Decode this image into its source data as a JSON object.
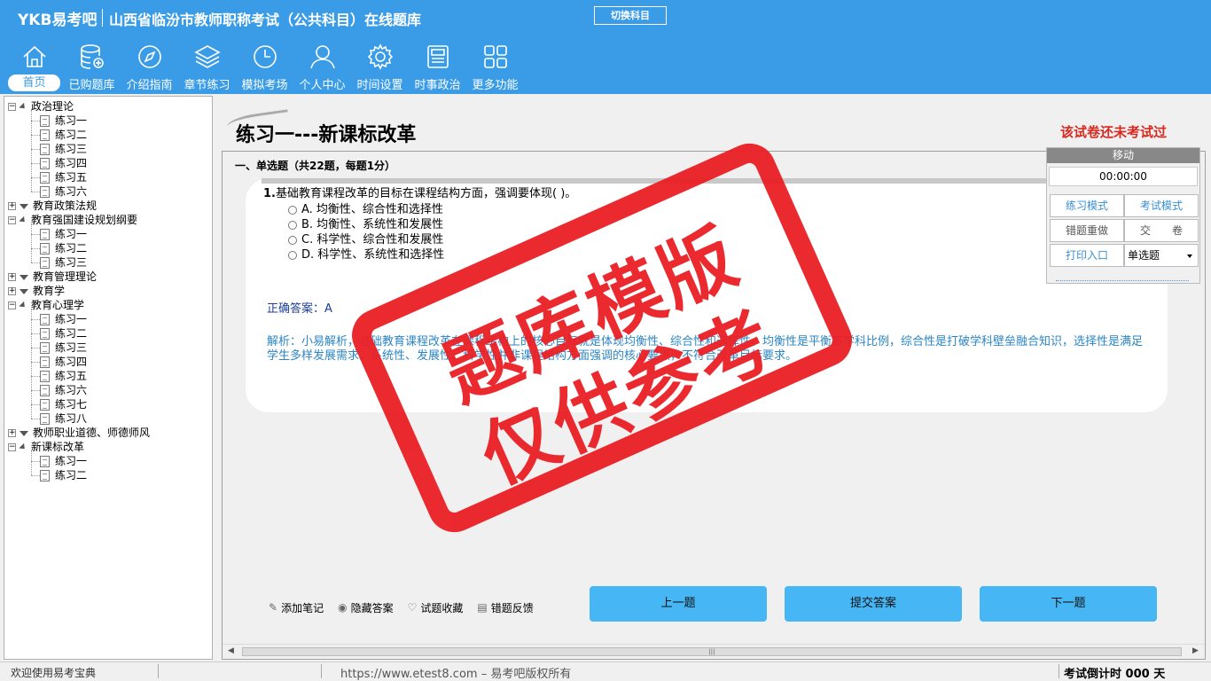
{
  "header": {
    "brand": "YKB易考吧",
    "title": "山西省临汾市教师职称考试（公共科目）在线题库",
    "switch_button": "切换科目"
  },
  "nav": [
    {
      "label": "首页",
      "icon": "home-icon"
    },
    {
      "label": "已购题库",
      "icon": "database-icon"
    },
    {
      "label": "介绍指南",
      "icon": "compass-icon"
    },
    {
      "label": "章节练习",
      "icon": "layers-icon"
    },
    {
      "label": "模拟考场",
      "icon": "clock-icon"
    },
    {
      "label": "个人中心",
      "icon": "user-icon"
    },
    {
      "label": "时间设置",
      "icon": "gear-icon"
    },
    {
      "label": "时事政治",
      "icon": "news-icon"
    },
    {
      "label": "更多功能",
      "icon": "grid-icon"
    }
  ],
  "tree": {
    "sections": [
      {
        "label": "政治理论",
        "expanded": true,
        "items": [
          "练习一",
          "练习二",
          "练习三",
          "练习四",
          "练习五",
          "练习六"
        ]
      },
      {
        "label": "教育政策法规",
        "expanded": false,
        "items": []
      },
      {
        "label": "教育强国建设规划纲要",
        "expanded": true,
        "items": [
          "练习一",
          "练习二",
          "练习三"
        ]
      },
      {
        "label": "教育管理理论",
        "expanded": false,
        "items": []
      },
      {
        "label": "教育学",
        "expanded": false,
        "items": []
      },
      {
        "label": "教育心理学",
        "expanded": true,
        "items": [
          "练习一",
          "练习二",
          "练习三",
          "练习四",
          "练习五",
          "练习六",
          "练习七",
          "练习八"
        ]
      },
      {
        "label": "教师职业道德、师德师风",
        "expanded": false,
        "items": []
      },
      {
        "label": "新课标改革",
        "expanded": true,
        "items": [
          "练习一",
          "练习二"
        ]
      }
    ]
  },
  "exam": {
    "title": "练习一---新课标改革",
    "status": "该试卷还未考试过",
    "section_head": "一、单选题（共22题，每题1分）",
    "question_no": "1.",
    "question": "基础教育课程改革的目标在课程结构方面，强调要体现( )。",
    "options": [
      "A. 均衡性、综合性和选择性",
      "B. 均衡性、系统性和发展性",
      "C. 科学性、综合性和发展性",
      "D. 科学性、系统性和选择性"
    ],
    "answer_label": "正确答案：",
    "answer_value": "A",
    "analysis": "解析：小易解析，基础教育课程改革在课程结构上的核心目标就是体现均衡性、综合性和选择性。均衡性是平衡各学科比例，综合性是打破学科壁垒融合知识，选择性是满足学生多样发展需求。系统性、发展性、科学性并非课程结构方面强调的核心要点，不符合改革目标要求。"
  },
  "tools": [
    {
      "label": "添加笔记",
      "icon": "pencil-icon"
    },
    {
      "label": "隐藏答案",
      "icon": "eye-icon"
    },
    {
      "label": "试题收藏",
      "icon": "heart-icon"
    },
    {
      "label": "错题反馈",
      "icon": "feedback-icon"
    }
  ],
  "buttons": {
    "prev": "上一题",
    "submit": "提交答案",
    "next": "下一题"
  },
  "float_panel": {
    "head": "移动",
    "timer": "00:00:00",
    "practice_mode": "练习模式",
    "exam_mode": "考试模式",
    "redo_wrong": "错题重做",
    "hand_in": "交　　卷",
    "print": "打印入口",
    "question_type": "单选题"
  },
  "stamp": {
    "line1": "题库模版",
    "line2": "仅供参考"
  },
  "status": {
    "welcome": "欢迎使用易考宝典",
    "copyright": "https://www.etest8.com – 易考吧版权所有",
    "countdown": "考试倒计时 000 天"
  },
  "colors": {
    "header": "#3a9be6",
    "accent_button": "#46b6f4",
    "alert_red": "#d9281e",
    "stamp_red": "#ea1f25"
  }
}
